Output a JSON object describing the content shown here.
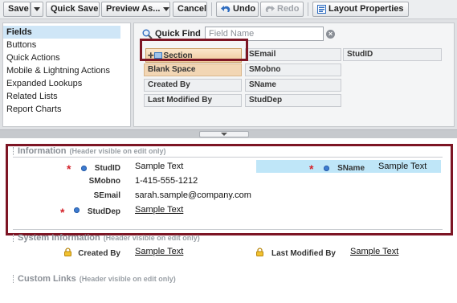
{
  "toolbar": {
    "save": "Save",
    "quick_save": "Quick Save",
    "preview_as": "Preview As...",
    "cancel": "Cancel",
    "undo": "Undo",
    "redo": "Redo",
    "layout_properties": "Layout Properties"
  },
  "palette": {
    "categories": [
      "Fields",
      "Buttons",
      "Quick Actions",
      "Mobile & Lightning Actions",
      "Expanded Lookups",
      "Related Lists",
      "Report Charts"
    ],
    "selected_category": "Fields",
    "quick_find_label": "Quick Find",
    "quick_find_placeholder": "Field Name",
    "field_tiles": [
      "Section",
      "Blank Space",
      "Created By",
      "Last Modified By",
      "SEmail",
      "SMobno",
      "SName",
      "StudDep",
      "StudID"
    ]
  },
  "layout": {
    "information": {
      "title": "Information",
      "note": "(Header visible on edit only)",
      "fields": [
        {
          "label": "StudID",
          "value": "Sample Text",
          "required": true
        },
        {
          "label": "SMobno",
          "value": "1-415-555-1212",
          "required": false
        },
        {
          "label": "SEmail",
          "value": "sarah.sample@company.com",
          "required": false
        },
        {
          "label": "StudDep",
          "value": "Sample Text",
          "required": true
        },
        {
          "label": "SName",
          "value": "Sample Text",
          "required": true
        }
      ]
    },
    "system_information": {
      "title": "System Information",
      "note": "(Header visible on edit only)",
      "fields": [
        {
          "label": "Created By",
          "value": "Sample Text"
        },
        {
          "label": "Last Modified By",
          "value": "Sample Text"
        }
      ]
    },
    "custom_links": {
      "title": "Custom Links",
      "note": "(Header visible on edit only)"
    }
  },
  "colors": {
    "highlight_frame": "#7d1524",
    "required_marker": "#d4232b",
    "selected_band": "#bfe6f8",
    "section_tile": "#efc99a"
  }
}
